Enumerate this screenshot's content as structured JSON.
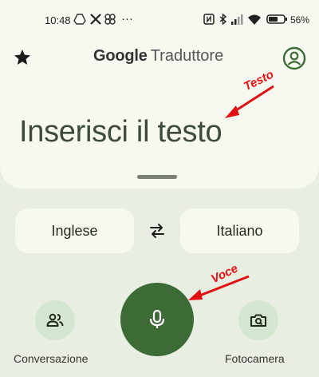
{
  "status_bar": {
    "time": "10:48",
    "more_indicator": "···",
    "battery_percent": "56%",
    "icons": [
      "drive-icon",
      "x-icon",
      "pinwheel-icon",
      "nfc-icon",
      "bluetooth-icon",
      "signal-icon",
      "wifi-icon",
      "battery-icon"
    ]
  },
  "app_bar": {
    "brand": "Google",
    "product": "Traduttore",
    "favorites_icon": "star-icon",
    "account_icon": "account-circle-icon"
  },
  "input": {
    "placeholder": "Inserisci il testo"
  },
  "languages": {
    "source": "Inglese",
    "target": "Italiano",
    "swap_icon": "swap-arrows-icon"
  },
  "actions": {
    "conversation_label": "Conversazione",
    "camera_label": "Fotocamera",
    "microphone_icon": "microphone-icon"
  },
  "annotations": {
    "text_callout": "Testo",
    "voice_callout": "Voce",
    "color": "#e11111"
  },
  "colors": {
    "background": "#e9eee3",
    "panel": "#f7f9f1",
    "accent": "#3d6b36",
    "secondary_button": "#d4e6cf"
  }
}
